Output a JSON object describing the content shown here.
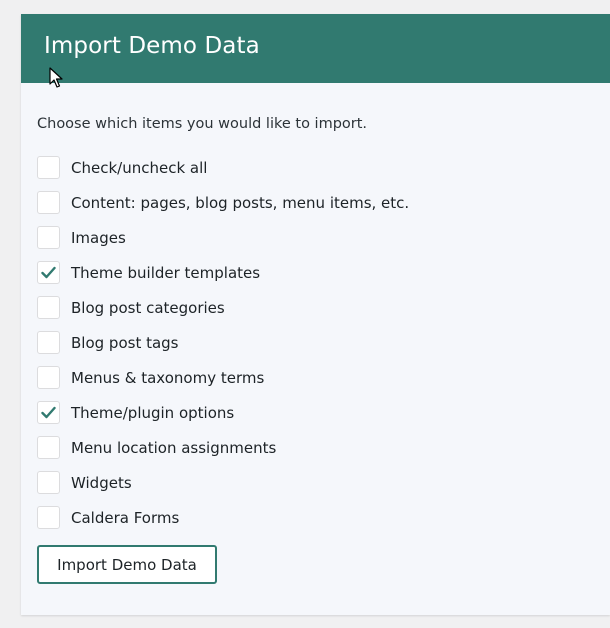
{
  "panel": {
    "title": "Import Demo Data",
    "intro": "Choose which items you would like to import.",
    "items": [
      {
        "label": "Check/uncheck all",
        "checked": false
      },
      {
        "label": "Content: pages, blog posts, menu items, etc.",
        "checked": false
      },
      {
        "label": "Images",
        "checked": false
      },
      {
        "label": "Theme builder templates",
        "checked": true
      },
      {
        "label": "Blog post categories",
        "checked": false
      },
      {
        "label": "Blog post tags",
        "checked": false
      },
      {
        "label": "Menus & taxonomy terms",
        "checked": false
      },
      {
        "label": "Theme/plugin options",
        "checked": true
      },
      {
        "label": "Menu location assignments",
        "checked": false
      },
      {
        "label": "Widgets",
        "checked": false
      },
      {
        "label": "Caldera Forms",
        "checked": false
      }
    ],
    "button_label": "Import Demo Data"
  },
  "colors": {
    "accent": "#317a70",
    "panel_background": "#f5f7fb",
    "text": "#1d2327"
  },
  "icons": {
    "check": "checkmark-icon",
    "cursor": "mouse-pointer-icon"
  }
}
